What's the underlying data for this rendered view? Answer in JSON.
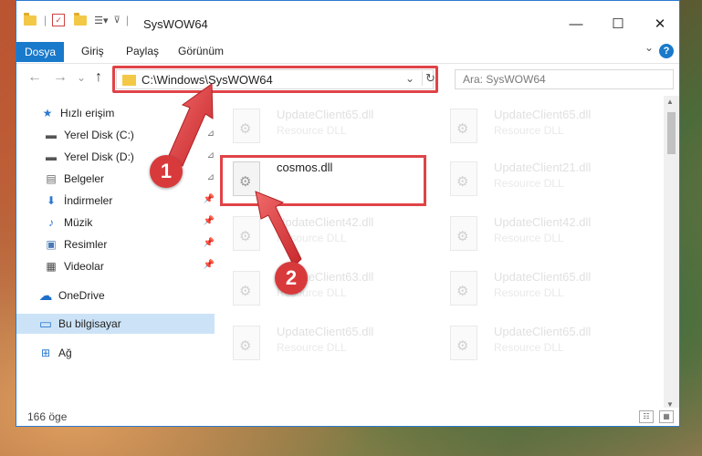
{
  "window": {
    "title": "SysWOW64",
    "minimize": "—",
    "maximize": "☐",
    "close": "✕"
  },
  "ribbon": {
    "tabs": [
      "Dosya",
      "Giriş",
      "Paylaş",
      "Görünüm"
    ],
    "help": "?",
    "collapse": "⌄"
  },
  "nav": {
    "back": "←",
    "forward": "→",
    "recent": "⌄",
    "up": "↑",
    "address": "C:\\Windows\\SysWOW64",
    "dropdown": "⌄",
    "refresh": "↻",
    "search_placeholder": "Ara: SysWOW64"
  },
  "sidebar": {
    "items": [
      {
        "label": "Hızlı erişim",
        "icon": "star-icon",
        "glyph": "★",
        "color": "#2b79d0"
      },
      {
        "label": "Yerel Disk (C:)",
        "icon": "drive-icon",
        "glyph": "▬",
        "color": "#555555",
        "pin": "⊿"
      },
      {
        "label": "Yerel Disk (D:)",
        "icon": "drive-icon",
        "glyph": "▬",
        "color": "#555555",
        "pin": "⊿"
      },
      {
        "label": "Belgeler",
        "icon": "document-icon",
        "glyph": "▤",
        "color": "#666666",
        "pin": "⊿"
      },
      {
        "label": "İndirmeler",
        "icon": "download-icon",
        "glyph": "⬇",
        "color": "#2b79d0",
        "pin": "📌"
      },
      {
        "label": "Müzik",
        "icon": "music-icon",
        "glyph": "♪",
        "color": "#2b79d0",
        "pin": "📌"
      },
      {
        "label": "Resimler",
        "icon": "pictures-icon",
        "glyph": "▣",
        "color": "#4a7ab5",
        "pin": "📌"
      },
      {
        "label": "Videolar",
        "icon": "video-icon",
        "glyph": "▦",
        "color": "#444444",
        "pin": "📌"
      },
      {
        "label": "OneDrive",
        "icon": "cloud-icon",
        "glyph": "☁",
        "color": "#1e6fc8"
      },
      {
        "label": "Bu bilgisayar",
        "icon": "computer-icon",
        "glyph": "▭",
        "color": "#2b79d0"
      },
      {
        "label": "Ağ",
        "icon": "network-icon",
        "glyph": "⊞",
        "color": "#2b79d0"
      }
    ]
  },
  "files": [
    {
      "name": "UpdateClient65.dll",
      "type": "Resource DLL"
    },
    {
      "name": "UpdateClient65.dll",
      "type": "Resource DLL"
    },
    {
      "name": "cosmos.dll",
      "type": ""
    },
    {
      "name": "UpdateClient21.dll",
      "type": "Resource DLL"
    },
    {
      "name": "UpdateClient42.dll",
      "type": "Resource DLL"
    },
    {
      "name": "UpdateClient42.dll",
      "type": "Resource DLL"
    },
    {
      "name": "UpdateClient63.dll",
      "type": "Resource DLL"
    },
    {
      "name": "UpdateClient65.dll",
      "type": "Resource DLL"
    },
    {
      "name": "UpdateClient65.dll",
      "type": "Resource DLL"
    },
    {
      "name": "UpdateClient65.dll",
      "type": "Resource DLL"
    }
  ],
  "status": {
    "count": "166 öge"
  },
  "annotations": {
    "step1": "1",
    "step2": "2",
    "accent": "#e04347"
  },
  "colors": {
    "ribbon_blue": "#1979ca",
    "selection": "#cce3f7"
  }
}
